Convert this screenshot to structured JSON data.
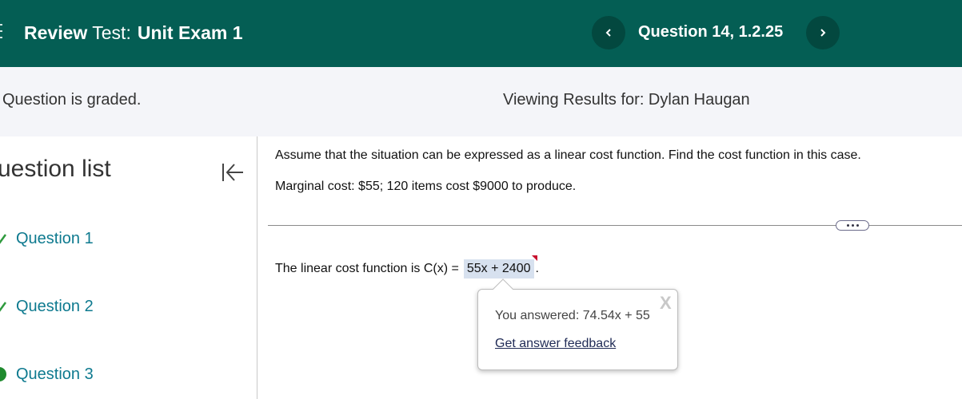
{
  "header": {
    "review_label": "Review",
    "test_label": "Test:",
    "exam_name": "Unit Exam 1",
    "question_label": "Question 14, 1.2.25",
    "prev_icon": "chevron-left-icon",
    "next_icon": "chevron-right-icon",
    "bar_color": "#045e54"
  },
  "status": {
    "graded_text": "Question is graded.",
    "viewing_text": "Viewing Results for: Dylan Haugan"
  },
  "sidebar": {
    "title": "uestion list",
    "collapse_icon": "collapse-left-icon",
    "items": [
      {
        "label": "Question 1",
        "icon": "partial-check-icon"
      },
      {
        "label": "Question 2",
        "icon": "partial-check-icon"
      },
      {
        "label": "Question 3",
        "icon": "correct-circle-icon"
      }
    ]
  },
  "question": {
    "prompt": "Assume that the situation can be expressed as a linear cost function. Find the cost function in this case.",
    "given": "Marginal cost: $55; 120 items cost $9000 to produce.",
    "answer_prefix": "The linear cost function is C(x) =",
    "answer_value": "55x + 2400",
    "answer_suffix": "."
  },
  "popup": {
    "close_label": "X",
    "you_answered": "You answered: 74.54x + 55",
    "feedback_link": "Get answer feedback"
  }
}
